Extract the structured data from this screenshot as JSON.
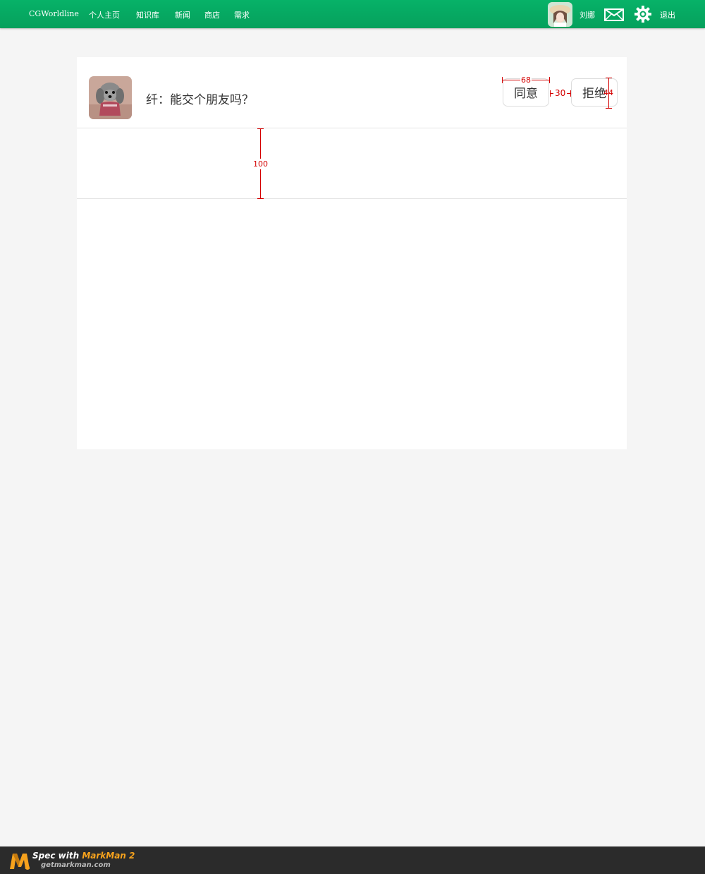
{
  "nav": {
    "brand": "CGWorldline",
    "items": [
      "个人主页",
      "知识库",
      "新闻",
      "商店",
      "需求"
    ],
    "username": "刘娜",
    "logout": "退出"
  },
  "request": {
    "message": "纤：能交个朋友吗？",
    "agree_label": "同意",
    "reject_label": "拒绝"
  },
  "annotations": {
    "button_width": "68",
    "button_gap": "30",
    "button_height": "44",
    "row_height": "100"
  },
  "footer": {
    "spec_prefix": "Spec with ",
    "spec_brand": "MarkMan 2",
    "site": "getmarkman.com"
  },
  "colors": {
    "nav_green": "#07b268",
    "annotation_red": "#d40000",
    "footer_bg": "#2b2b2b",
    "markman_orange": "#f6a21d"
  }
}
